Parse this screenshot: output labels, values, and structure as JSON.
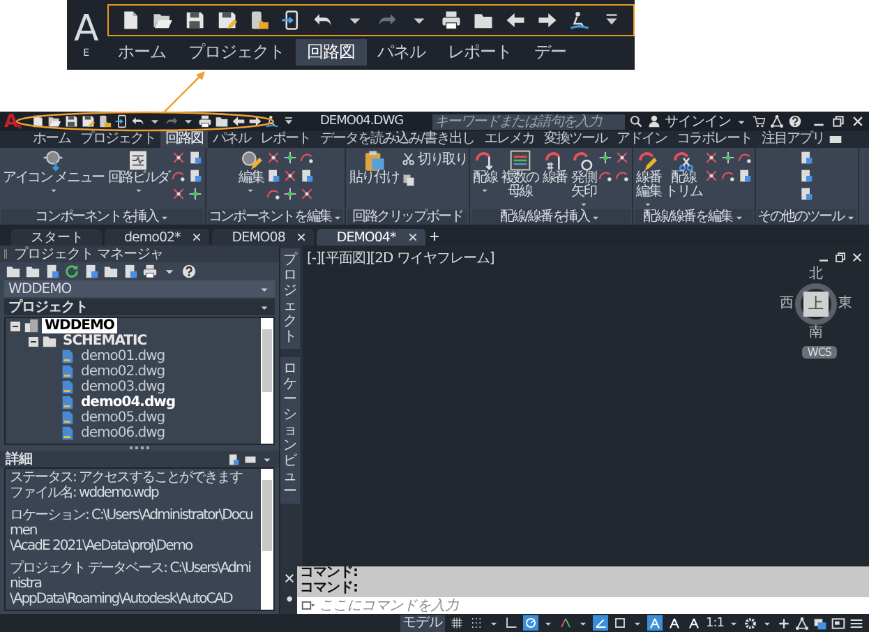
{
  "callout": {
    "logo": {
      "mark": "A",
      "edition": "E"
    },
    "redo_enabled": false,
    "tabs": [
      {
        "label": "ホーム",
        "selected": false
      },
      {
        "label": "プロジェクト",
        "selected": false
      },
      {
        "label": "回路図",
        "selected": true
      },
      {
        "label": "パネル",
        "selected": false
      },
      {
        "label": "レポート",
        "selected": false
      },
      {
        "label": "デー",
        "selected": false
      }
    ]
  },
  "title_bar": {
    "logo": {
      "mark": "A",
      "edition": "E"
    },
    "redo_enabled": false,
    "title": "DEMO04.DWG",
    "search": {
      "placeholder": "キーワードまたは語句を入力"
    },
    "user": "サインイン"
  },
  "ribbon": {
    "tabs": [
      {
        "label": "ホーム",
        "selected": false
      },
      {
        "label": "プロジェクト",
        "selected": false
      },
      {
        "label": "回路図",
        "selected": true
      },
      {
        "label": "パネル",
        "selected": false
      },
      {
        "label": "レポート",
        "selected": false
      },
      {
        "label": "データを読み込み/書き出し",
        "selected": false
      },
      {
        "label": "エレメカ",
        "selected": false
      },
      {
        "label": "変換ツール",
        "selected": false
      },
      {
        "label": "アドイン",
        "selected": false
      },
      {
        "label": "コラボレート",
        "selected": false
      },
      {
        "label": "注目アプリ",
        "selected": false
      }
    ],
    "panels": [
      {
        "label": "コンポーネントを挿入",
        "expandable": true,
        "buttons": [
          {
            "kind": "icon-menu",
            "label_lines": [
              "アイコン メニュー"
            ],
            "has_menu": true
          },
          {
            "kind": "circuit-builder",
            "label_lines": [
              "回路ビルダ"
            ],
            "has_menu": true
          }
        ]
      },
      {
        "label": "コンポーネントを編集",
        "expandable": true,
        "buttons": [
          {
            "kind": "edit",
            "label_lines": [
              "編集"
            ],
            "has_menu": true
          }
        ]
      },
      {
        "label": "回路クリップボード",
        "expandable": false,
        "buttons": [
          {
            "kind": "paste",
            "label_lines": [
              "貼り付け"
            ],
            "has_menu": false
          }
        ],
        "small_buttons": [
          {
            "kind": "cut",
            "label": "切り取り"
          }
        ]
      },
      {
        "label": "配線/線番を挿入",
        "expandable": true,
        "buttons": [
          {
            "kind": "wire",
            "label_lines": [
              "配線"
            ],
            "has_menu": true
          },
          {
            "kind": "multi-bus",
            "label_lines": [
              "複数の",
              "母線"
            ],
            "has_menu": false
          },
          {
            "kind": "wire-number",
            "label_lines": [
              "線番"
            ],
            "has_menu": false
          },
          {
            "kind": "source-arrow",
            "label_lines": [
              "発側",
              "矢印"
            ],
            "has_menu": true
          }
        ]
      },
      {
        "label": "配線/線番を編集",
        "expandable": true,
        "buttons": [
          {
            "kind": "wire-number-edit",
            "label_lines": [
              "線番",
              "編集"
            ],
            "has_menu": true
          },
          {
            "kind": "trim-wire",
            "label_lines": [
              "配線",
              "トリム"
            ],
            "has_menu": false
          }
        ]
      },
      {
        "label": "その他のツール",
        "expandable": true
      }
    ]
  },
  "document_tabs": [
    {
      "label": "スタート",
      "selected": false,
      "closable": false
    },
    {
      "label": "demo02*",
      "selected": false,
      "closable": true
    },
    {
      "label": "DEMO08",
      "selected": false,
      "closable": true
    },
    {
      "label": "DEMO04*",
      "selected": true,
      "closable": true
    }
  ],
  "project_manager": {
    "title": "プロジェクト マネージャ",
    "project_dropdown": "WDDEMO",
    "view_dropdown": "プロジェクト",
    "tree": [
      {
        "kind": "project",
        "label": "WDDEMO",
        "selected": true,
        "expanded": true,
        "children": [
          {
            "kind": "folder",
            "label": "SCHEMATIC",
            "selected": false,
            "expanded": true,
            "children": [
              {
                "kind": "drawing",
                "label": "demo01.dwg",
                "selected": false,
                "current": false
              },
              {
                "kind": "drawing",
                "label": "demo02.dwg",
                "selected": false,
                "current": false
              },
              {
                "kind": "drawing",
                "label": "demo03.dwg",
                "selected": false,
                "current": false
              },
              {
                "kind": "drawing",
                "label": "demo04.dwg",
                "selected": false,
                "current": true
              },
              {
                "kind": "drawing",
                "label": "demo05.dwg",
                "selected": false,
                "current": false
              },
              {
                "kind": "drawing",
                "label": "demo06.dwg",
                "selected": false,
                "current": false
              }
            ]
          }
        ]
      }
    ],
    "details": {
      "title": "詳細",
      "groups": [
        [
          "ステータス: アクセスすることができます",
          "ファイル名: wddemo.wdp"
        ],
        [
          "ロケーション: C:\\Users\\Administrator\\Documen",
          "\\AcadE 2021\\AeData\\proj\\Demo"
        ],
        [
          "プロジェクト データベース: C:\\Users\\Administra",
          "\\AppData\\Roaming\\Autodesk\\AutoCAD"
        ]
      ]
    }
  },
  "side_tabs": [
    "プロジェクト",
    "ロケーションビュー"
  ],
  "viewport": {
    "label": "[-][平面図][2D ワイヤフレーム]",
    "viewcube": {
      "top": "上",
      "north": "北",
      "south": "南",
      "east": "東",
      "west": "西"
    },
    "ucs": "WCS"
  },
  "command": {
    "history": [
      "コマンド:",
      "コマンド:"
    ],
    "placeholder": "ここにコマンドを入力"
  },
  "status_bar": {
    "model": "モデル",
    "scale": "1:1",
    "toggles": [
      {
        "on": false
      },
      {
        "on": false
      },
      {
        "on": false
      },
      {
        "on": true
      },
      {
        "on": false
      },
      {
        "on": true
      },
      {
        "on": false
      },
      {
        "on": true
      },
      {
        "on": false
      },
      {
        "on": false
      }
    ]
  }
}
